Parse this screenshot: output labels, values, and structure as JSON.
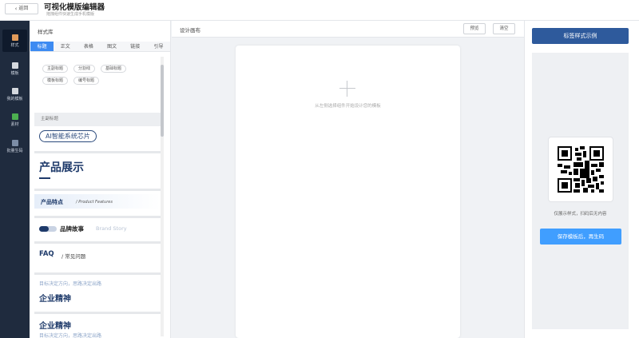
{
  "header": {
    "back_label": "返回",
    "title": "可视化模版编辑器",
    "subtitle": "拖拽组件快速生成手机模版"
  },
  "nav": {
    "items": [
      {
        "label": "样式",
        "icon": "style-icon",
        "color": "#e09a5a"
      },
      {
        "label": "模板",
        "icon": "template-icon",
        "color": "#d4d8de"
      },
      {
        "label": "我的模板",
        "icon": "my-template-icon",
        "color": "#d4d8de"
      },
      {
        "label": "素材",
        "icon": "material-icon",
        "color": "#4caf50"
      },
      {
        "label": "批量生码",
        "icon": "batch-code-icon",
        "color": "#7c8da6"
      }
    ]
  },
  "library": {
    "title": "样式库",
    "tabs": [
      "标题",
      "正文",
      "表格",
      "图文",
      "链接",
      "引导"
    ],
    "active_tab": 0,
    "quick_buttons": [
      "主副标题",
      "分割线",
      "基础标题",
      "模板标题",
      "编号标题"
    ],
    "group_label": "主副标题",
    "cards": {
      "pill_title": "AI智能系统芯片",
      "big_title": "产品展示",
      "feature_title": "产品特点",
      "feature_sub": "/ Product Features",
      "brand_cn": "品牌故事",
      "brand_en": "Brand Story",
      "faq_q": "FAQ",
      "faq_cn": "/ 常见问题",
      "spirit1_sub": "目标决定方向，思路决定出路",
      "spirit1_title": "企业精神",
      "spirit2_title": "企业精神",
      "spirit2_sub": "目标决定方向，思路决定出路"
    }
  },
  "canvas": {
    "title": "设计画布",
    "preview_label": "预览",
    "clear_label": "清空",
    "empty_hint": "从左侧选择组件开始设计您的模板"
  },
  "right_panel": {
    "example_label": "标签样式示例",
    "qr_hint": "仅展示样式，扫码后无内容",
    "save_label": "保存模板后，再生码"
  }
}
